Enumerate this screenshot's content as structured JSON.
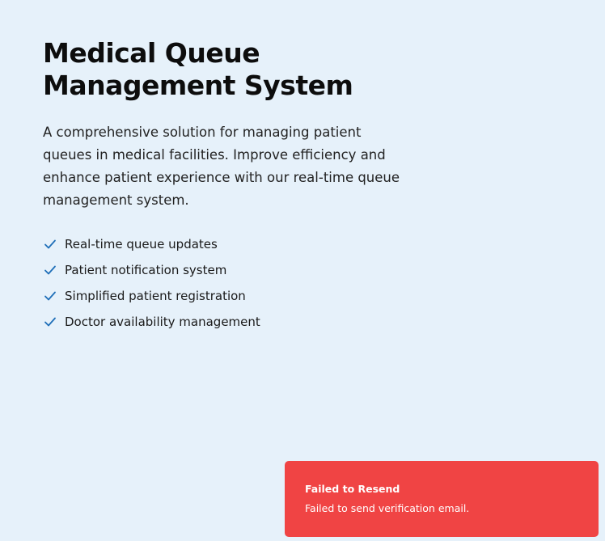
{
  "hero": {
    "title": "Medical Queue Management System",
    "description": "A comprehensive solution for managing patient queues in medical facilities. Improve efficiency and enhance patient experience with our real-time queue management system."
  },
  "features": [
    {
      "label": "Real-time queue updates",
      "icon": "check-icon"
    },
    {
      "label": "Patient notification system",
      "icon": "check-icon"
    },
    {
      "label": "Simplified patient registration",
      "icon": "check-icon"
    },
    {
      "label": "Doctor availability management",
      "icon": "check-icon"
    }
  ],
  "toast": {
    "title": "Failed to Resend",
    "message": "Failed to send verification email."
  },
  "colors": {
    "background": "#e6f1fa",
    "check": "#1f6fb8",
    "toast_bg": "#f04444"
  }
}
